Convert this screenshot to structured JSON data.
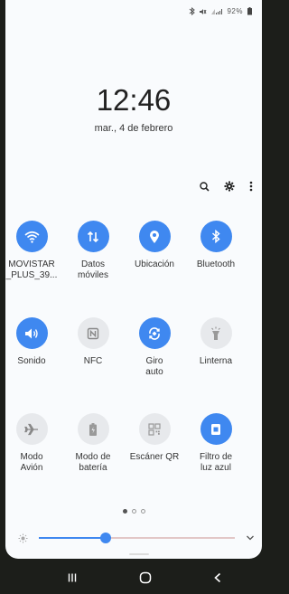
{
  "status_bar": {
    "icons": [
      "bluetooth-icon",
      "mute-icon",
      "wifi-signal-icon"
    ],
    "battery": "92%"
  },
  "clock": {
    "time": "12:46",
    "date": "mar., 4 de febrero"
  },
  "toolbar": {
    "icons": [
      "search-icon",
      "gear-icon",
      "more-options-icon"
    ]
  },
  "tiles": [
    {
      "label": "MOVISTAR\n_PLUS_39...",
      "icon": "wifi-icon",
      "active": true
    },
    {
      "label": "Datos\nmóviles",
      "icon": "data-arrows-icon",
      "active": true
    },
    {
      "label": "Ubicación",
      "icon": "location-pin-icon",
      "active": true
    },
    {
      "label": "Bluetooth",
      "icon": "bluetooth-icon",
      "active": true
    },
    {
      "label": "Sonido",
      "icon": "speaker-icon",
      "active": true
    },
    {
      "label": "NFC",
      "icon": "nfc-icon",
      "active": false
    },
    {
      "label": "Giro\nauto",
      "icon": "rotate-icon",
      "active": true
    },
    {
      "label": "Linterna",
      "icon": "flashlight-icon",
      "active": false
    },
    {
      "label": "Modo\nAvión",
      "icon": "airplane-icon",
      "active": false
    },
    {
      "label": "Modo de\nbatería",
      "icon": "battery-icon",
      "active": false
    },
    {
      "label": "Escáner QR",
      "icon": "qr-icon",
      "active": false
    },
    {
      "label": "Filtro de\nluz azul",
      "icon": "blue-light-icon",
      "active": true
    }
  ],
  "pager": {
    "pages": 3,
    "current": 0
  },
  "brightness": {
    "level": 0.34,
    "icon": "sun-icon"
  },
  "colors": {
    "accent": "#3f88f0",
    "inactive": "#e7e9ec",
    "panel": "#f9fbfd",
    "nav": "#1c1e1a"
  },
  "navbar": {
    "icons": [
      "recents-icon",
      "home-icon",
      "back-icon"
    ]
  }
}
